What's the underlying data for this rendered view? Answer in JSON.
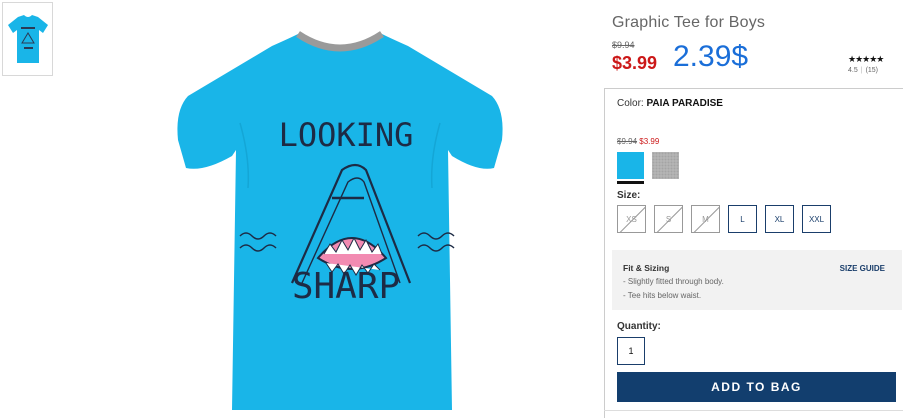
{
  "product": {
    "title": "Graphic Tee for Boys",
    "original_price": "$9.94",
    "sale_price": "$3.99",
    "overlay_price": "2.39$",
    "rating_stars": "★★★★★",
    "rating_value": "4.5",
    "review_count": "(15)"
  },
  "shirt_art": {
    "line1": "LOOKING",
    "line2": "SHARP"
  },
  "color": {
    "label": "Color: ",
    "value": "PAIA PARADISE",
    "swatch_original_price": "$9.94",
    "swatch_sale_price": "$3.99",
    "swatches": [
      {
        "name": "blue",
        "color": "#19b5e8",
        "selected": true
      },
      {
        "name": "gray",
        "color": "#b8b8b8",
        "selected": false
      }
    ]
  },
  "size": {
    "label": "Size:",
    "options": [
      {
        "label": "XS",
        "available": false
      },
      {
        "label": "S",
        "available": false
      },
      {
        "label": "M",
        "available": false
      },
      {
        "label": "L",
        "available": true
      },
      {
        "label": "XL",
        "available": true
      },
      {
        "label": "XXL",
        "available": true
      }
    ]
  },
  "fit": {
    "title": "Fit & Sizing",
    "size_guide": "SIZE GUIDE",
    "lines": [
      "- Slightly fitted through body.",
      "- Tee hits below waist."
    ]
  },
  "quantity": {
    "label": "Quantity:",
    "value": "1"
  },
  "cta": {
    "add_to_bag": "ADD TO BAG"
  },
  "colors": {
    "sale_red": "#cc1818",
    "navy": "#123e6e",
    "overlay_blue": "#1a6ed8",
    "shirt_blue": "#19b5e8"
  }
}
